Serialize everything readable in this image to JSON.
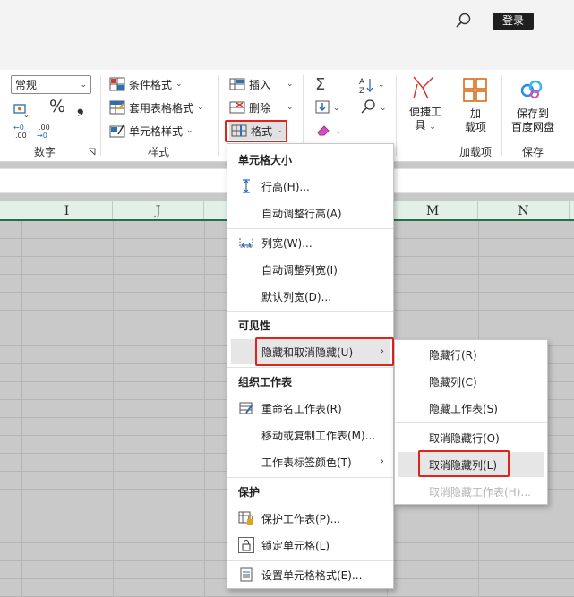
{
  "titlebar": {
    "search_icon": "search-icon",
    "login_label": "登录"
  },
  "ribbon": {
    "number": {
      "format_value": "常规",
      "group_label": "数字",
      "percent_symbol": "%",
      "comma_symbol": "❟"
    },
    "styles": {
      "conditional_format": "条件格式",
      "table_format": "套用表格格式",
      "cell_styles": "单元格样式",
      "group_label": "样式"
    },
    "cells": {
      "insert": "插入",
      "delete": "删除",
      "format": "格式"
    },
    "editing": {
      "sum_symbol": "Σ",
      "sort_symbol": "A/Z"
    },
    "tools": {
      "label_line1": "便捷工",
      "label_line2": "具"
    },
    "addins": {
      "label_line1": "加",
      "label_line2": "载项",
      "group_label": "加载项"
    },
    "save": {
      "label_line1": "保存到",
      "label_line2": "百度网盘",
      "group_label": "保存"
    }
  },
  "columns": [
    "I",
    "J",
    "M",
    "N"
  ],
  "format_menu": {
    "section_cell_size": "单元格大小",
    "row_height": "行高(H)...",
    "autofit_row": "自动调整行高(A)",
    "col_width": "列宽(W)...",
    "autofit_col": "自动调整列宽(I)",
    "default_width": "默认列宽(D)...",
    "section_visibility": "可见性",
    "hide_unhide": "隐藏和取消隐藏(U)",
    "section_organize": "组织工作表",
    "rename_sheet": "重命名工作表(R)",
    "move_copy_sheet": "移动或复制工作表(M)...",
    "tab_color": "工作表标签颜色(T)",
    "section_protect": "保护",
    "protect_sheet": "保护工作表(P)...",
    "lock_cell": "锁定单元格(L)",
    "format_cells": "设置单元格格式(E)..."
  },
  "hide_submenu": {
    "hide_rows": "隐藏行(R)",
    "hide_cols": "隐藏列(C)",
    "hide_sheet": "隐藏工作表(S)",
    "unhide_rows": "取消隐藏行(O)",
    "unhide_cols": "取消隐藏列(L)",
    "unhide_sheet": "取消隐藏工作表(H)..."
  },
  "colors": {
    "accent_green": "#217346",
    "highlight_red": "#e0241b",
    "menu_hover": "#e6e6e6"
  }
}
